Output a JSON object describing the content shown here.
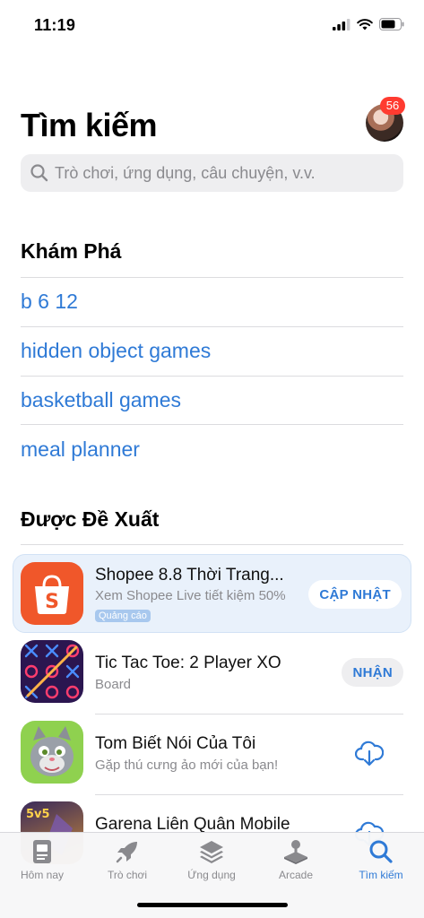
{
  "status": {
    "time": "11:19"
  },
  "header": {
    "title": "Tìm kiếm",
    "badge_count": "56"
  },
  "search": {
    "placeholder": "Trò chơi, ứng dụng, câu chuyện, v.v."
  },
  "explore": {
    "title": "Khám Phá",
    "items": [
      "b 6 12",
      "hidden object games",
      "basketball games",
      "meal planner"
    ]
  },
  "suggested": {
    "title": "Được Đề Xuất",
    "apps": [
      {
        "name": "Shopee 8.8 Thời Trang...",
        "subtitle": "Xem Shopee Live tiết kiệm 50%",
        "tag": "Quảng cáo",
        "action": "CẬP NHẬT",
        "icon": "shopee-icon"
      },
      {
        "name": "Tic Tac Toe: 2 Player XO",
        "subtitle": "Board",
        "action": "NHẬN",
        "icon": "tictactoe-icon"
      },
      {
        "name": "Tom Biết Nói Của Tôi",
        "subtitle": "Gặp thú cưng ảo mới của bạn!",
        "action": "download",
        "icon": "talking-tom-icon"
      },
      {
        "name": "Garena Liên Quân Mobile",
        "subtitle": "",
        "action": "download",
        "icon": "lien-quan-icon"
      }
    ]
  },
  "tabs": [
    {
      "label": "Hôm nay",
      "icon": "today-icon"
    },
    {
      "label": "Trò chơi",
      "icon": "rocket-icon"
    },
    {
      "label": "Ứng dụng",
      "icon": "apps-stack-icon"
    },
    {
      "label": "Arcade",
      "icon": "joystick-icon"
    },
    {
      "label": "Tìm kiếm",
      "icon": "search-icon",
      "active": true
    }
  ],
  "colors": {
    "accent": "#2f7ad6",
    "badge": "#ff3b30",
    "ad_background": "#e9f1fb"
  }
}
